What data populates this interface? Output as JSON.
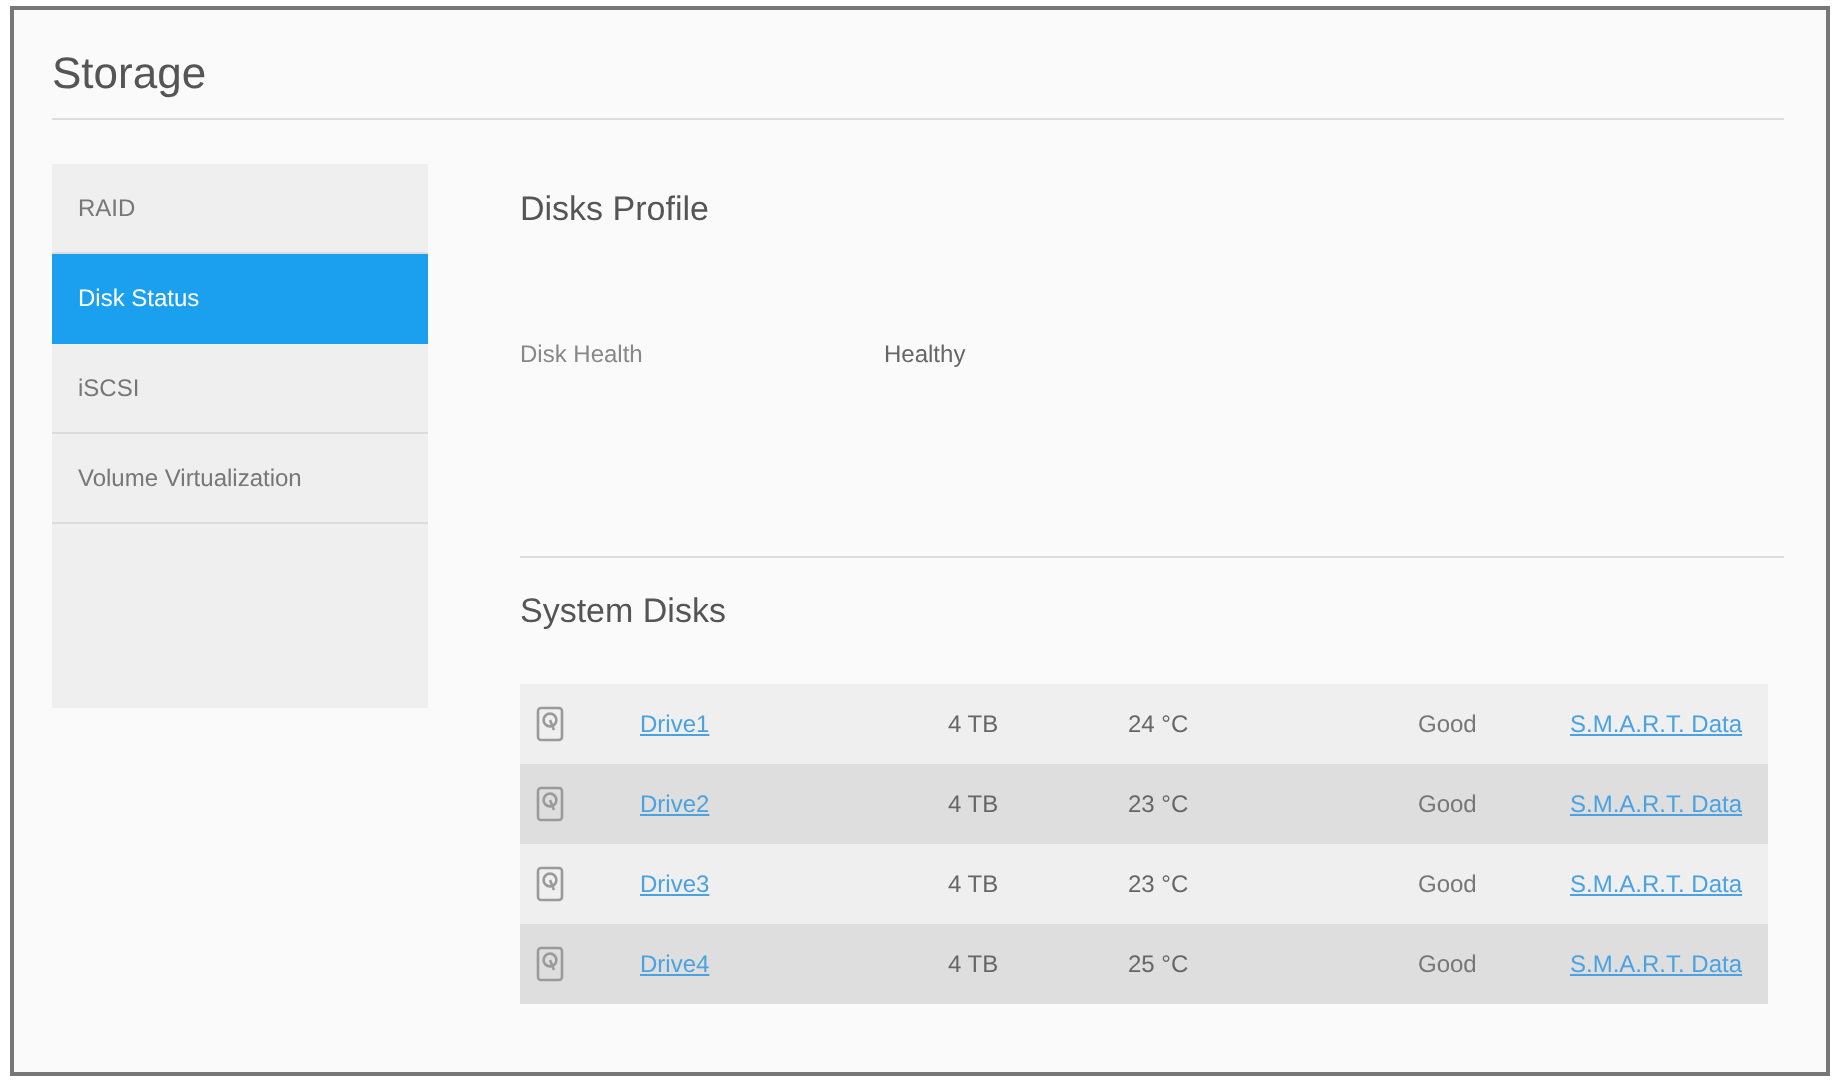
{
  "title": "Storage",
  "sidebar": {
    "items": [
      {
        "label": "RAID",
        "selected": false
      },
      {
        "label": "Disk Status",
        "selected": true
      },
      {
        "label": "iSCSI",
        "selected": false
      },
      {
        "label": "Volume Virtualization",
        "selected": false
      }
    ]
  },
  "disks_profile": {
    "heading": "Disks Profile",
    "fields": [
      {
        "label": "Disk Health",
        "value": "Healthy"
      }
    ]
  },
  "system_disks": {
    "heading": "System Disks",
    "rows": [
      {
        "name": "Drive1",
        "size": "4 TB",
        "temperature": "24 °C",
        "status": "Good",
        "link": "S.M.A.R.T. Data"
      },
      {
        "name": "Drive2",
        "size": "4 TB",
        "temperature": "23 °C",
        "status": "Good",
        "link": "S.M.A.R.T. Data"
      },
      {
        "name": "Drive3",
        "size": "4 TB",
        "temperature": "23 °C",
        "status": "Good",
        "link": "S.M.A.R.T. Data"
      },
      {
        "name": "Drive4",
        "size": "4 TB",
        "temperature": "25 °C",
        "status": "Good",
        "link": "S.M.A.R.T. Data"
      }
    ]
  }
}
